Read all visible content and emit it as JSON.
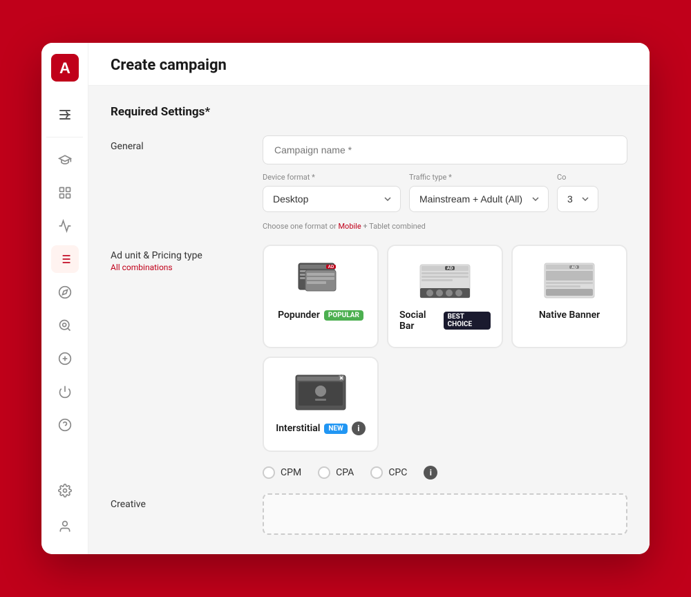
{
  "app": {
    "title": "Create campaign",
    "logo_letter": "A"
  },
  "sidebar": {
    "nav_items": [
      {
        "id": "courses",
        "icon": "graduation-cap-icon",
        "unicode": "🎓",
        "active": false
      },
      {
        "id": "dashboard",
        "icon": "grid-icon",
        "unicode": "⊞",
        "active": false
      },
      {
        "id": "analytics",
        "icon": "analytics-icon",
        "unicode": "📈",
        "active": false
      },
      {
        "id": "campaigns",
        "icon": "list-icon",
        "unicode": "☰",
        "active": true
      },
      {
        "id": "explore",
        "icon": "compass-icon",
        "unicode": "🧭",
        "active": false
      },
      {
        "id": "search",
        "icon": "search-icon",
        "unicode": "🔍",
        "active": false
      },
      {
        "id": "billing",
        "icon": "dollar-icon",
        "unicode": "$",
        "active": false
      },
      {
        "id": "power",
        "icon": "power-icon",
        "unicode": "⏻",
        "active": false
      },
      {
        "id": "help",
        "icon": "help-icon",
        "unicode": "?",
        "active": false
      }
    ],
    "bottom_items": [
      {
        "id": "settings",
        "icon": "settings-icon",
        "unicode": "⚙"
      },
      {
        "id": "profile",
        "icon": "profile-icon",
        "unicode": "👤"
      }
    ]
  },
  "required_settings": {
    "section_title": "Required Settings*",
    "general_label": "General",
    "campaign_name_placeholder": "Campaign name *",
    "device_format_label": "Device format *",
    "device_format_value": "Desktop",
    "device_format_hint_prefix": "Choose one format or",
    "device_format_hint_link": "Mobile",
    "device_format_hint_suffix": "+ Tablet combined",
    "traffic_type_label": "Traffic type *",
    "traffic_type_value": "Mainstream + Adult (All)",
    "country_label": "Co",
    "country_value": "3"
  },
  "ad_units": {
    "section_label": "Ad unit & Pricing type",
    "all_combinations": "All combinations",
    "cards": [
      {
        "id": "popunder",
        "name": "Popunder",
        "badge": "POPULAR",
        "badge_type": "popular"
      },
      {
        "id": "social-bar",
        "name": "Social Bar",
        "badge": "BEST CHOICE",
        "badge_type": "best"
      },
      {
        "id": "native-banner",
        "name": "Native Banner",
        "badge": "",
        "badge_type": ""
      },
      {
        "id": "interstitial",
        "name": "Interstitial",
        "badge": "NEW",
        "badge_type": "new"
      }
    ]
  },
  "pricing": {
    "options": [
      {
        "id": "cpm",
        "label": "CPM"
      },
      {
        "id": "cpa",
        "label": "CPA"
      },
      {
        "id": "cpc",
        "label": "CPC"
      }
    ]
  },
  "creative": {
    "label": "Creative"
  }
}
